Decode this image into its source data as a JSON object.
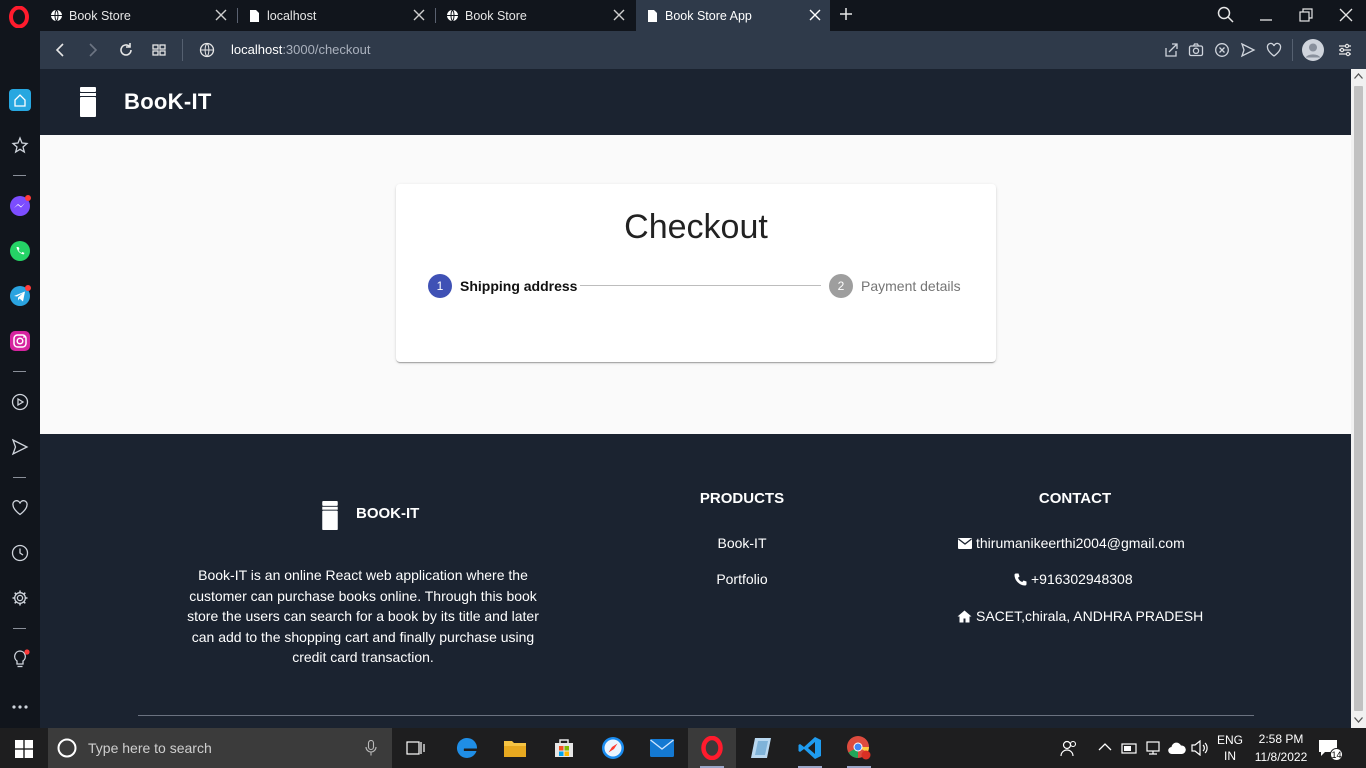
{
  "browser": {
    "tabs": [
      {
        "label": "Book Store",
        "icon": "globe-icon"
      },
      {
        "label": "localhost",
        "icon": "page-icon"
      },
      {
        "label": "Book Store",
        "icon": "globe-icon"
      },
      {
        "label": "Book Store App",
        "icon": "page-icon",
        "active": true
      }
    ],
    "url_host": "localhost",
    "url_path": ":3000/checkout"
  },
  "app": {
    "brand": "BooK-IT"
  },
  "checkout": {
    "title": "Checkout",
    "steps": [
      {
        "number": "1",
        "label": "Shipping address",
        "active": true
      },
      {
        "number": "2",
        "label": "Payment details",
        "active": false
      }
    ]
  },
  "footer": {
    "brand": "BOOK-IT",
    "description": "Book-IT is an online React web application where the customer can purchase books online. Through this book store the users can search for a book by its title and later can add to the shopping cart and finally purchase using credit card transaction.",
    "products_heading": "PRODUCTS",
    "products": [
      "Book-IT",
      "Portfolio"
    ],
    "contact_heading": "CONTACT",
    "email": "thirumanikeerthi2004@gmail.com",
    "phone": "+916302948308",
    "address": "SACET,chirala, ANDHRA PRADESH"
  },
  "taskbar": {
    "search_placeholder": "Type here to search",
    "lang_line1": "ENG",
    "lang_line2": "IN",
    "time": "2:58 PM",
    "date": "11/8/2022",
    "notification_count": "14"
  },
  "colors": {
    "app_bar": "#1b2330",
    "stepper_active": "#3f51b5",
    "stepper_inactive": "#9e9e9e",
    "opera_red": "#ff1b2d"
  }
}
